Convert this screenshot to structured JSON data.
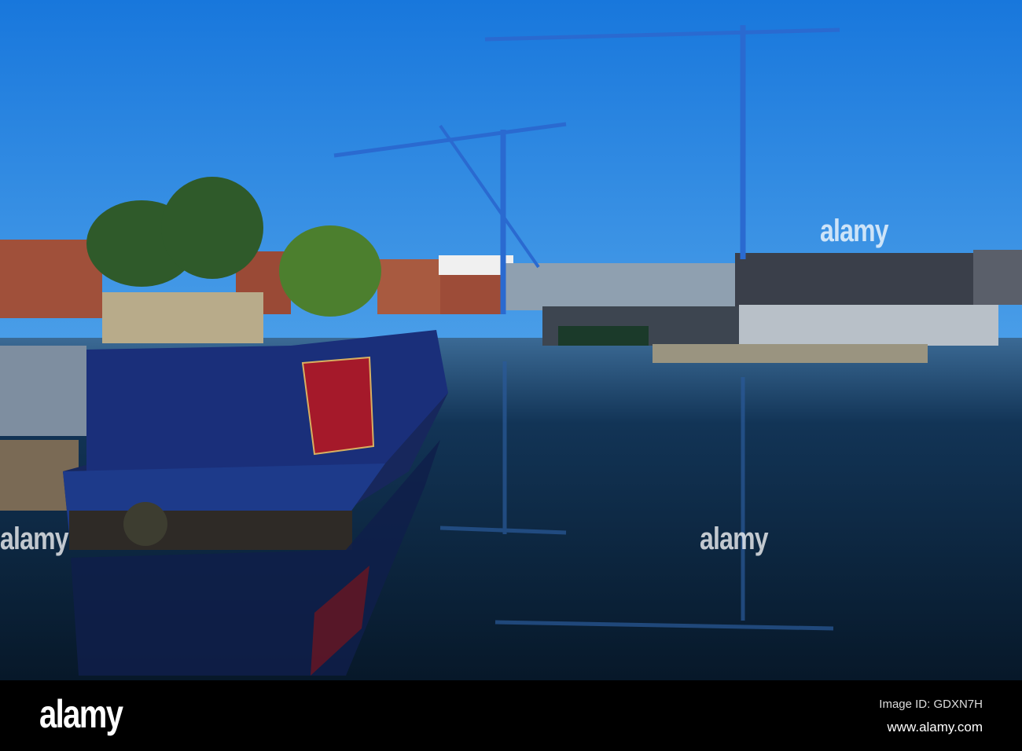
{
  "watermark_text": "alamy",
  "footer": {
    "logo": "alamy",
    "image_id": "Image ID: GDXN7H",
    "website": "www.alamy.com"
  },
  "colors": {
    "sky": "#1c7fe0",
    "water": "#0b2238",
    "boat_hull": "#1a2f7a",
    "boat_panel": "#a5192a",
    "crane": "#2a6ad0"
  }
}
